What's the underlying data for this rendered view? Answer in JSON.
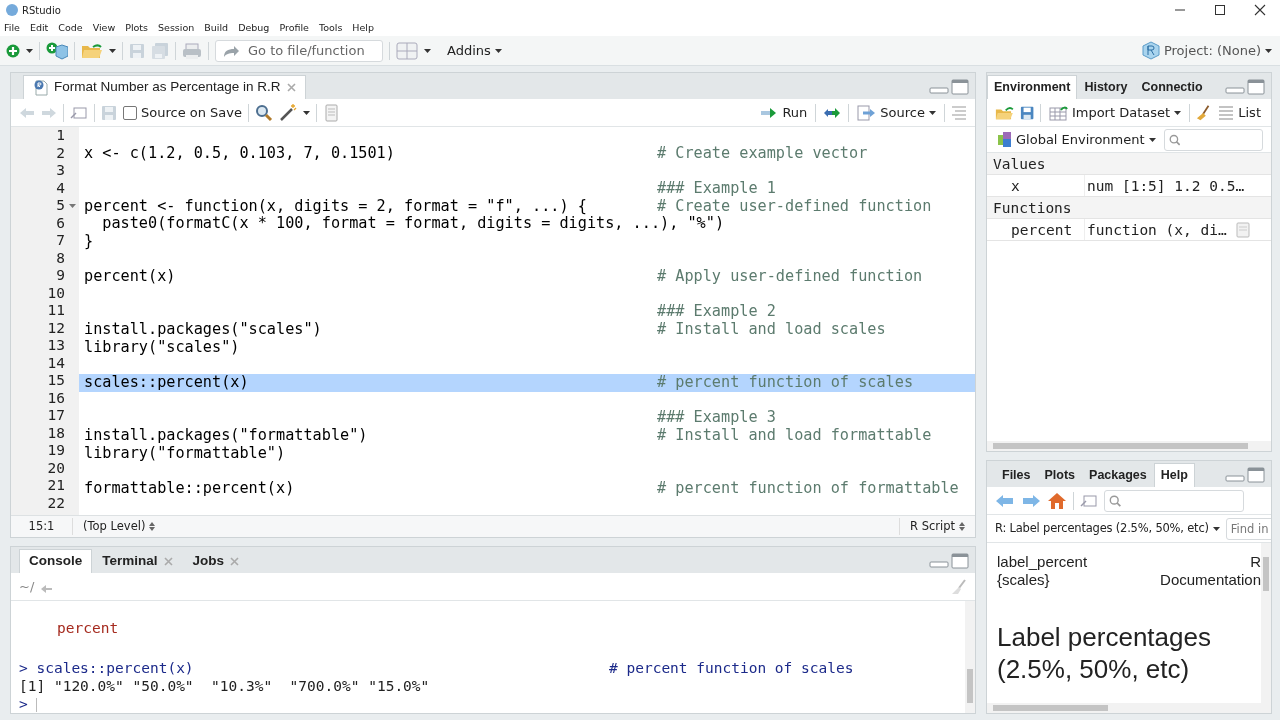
{
  "window": {
    "title": "RStudio"
  },
  "menu": [
    "File",
    "Edit",
    "Code",
    "View",
    "Plots",
    "Session",
    "Build",
    "Debug",
    "Profile",
    "Tools",
    "Help"
  ],
  "toolbar": {
    "goto_placeholder": "Go to file/function",
    "addins": "Addins",
    "project": "Project: (None)"
  },
  "source": {
    "tabs": [
      {
        "label": "Format Number as Percentage in R.R",
        "selected": true
      }
    ],
    "source_on_save": {
      "label": "Source on Save",
      "checked": false
    },
    "run": "Run",
    "source_button": "Source",
    "lines": [
      {
        "number": "1",
        "selected": false
      },
      {
        "number": "2",
        "code": "x <- c(1.2, 0.5, 0.103, 7, 0.1501)",
        "comment": "# Create example vector",
        "selected": false
      },
      {
        "number": "3",
        "selected": false
      },
      {
        "number": "4",
        "comment": "### Example 1",
        "selected": false
      },
      {
        "number": "5",
        "code": "percent <- function(x, digits = 2, format = \"f\", ...) {",
        "comment": "# Create user-defined function",
        "selected": false,
        "fold": true
      },
      {
        "number": "6",
        "code": "  paste0(formatC(x * 100, format = format, digits = digits, ...), \"%\")",
        "selected": false
      },
      {
        "number": "7",
        "code": "}",
        "selected": false
      },
      {
        "number": "8",
        "selected": false
      },
      {
        "number": "9",
        "code": "percent(x)",
        "comment": "# Apply user-defined function",
        "selected": false
      },
      {
        "number": "10",
        "selected": false
      },
      {
        "number": "11",
        "comment": "### Example 2",
        "selected": false
      },
      {
        "number": "12",
        "code": "install.packages(\"scales\")",
        "comment": "# Install and load scales",
        "selected": false
      },
      {
        "number": "13",
        "code": "library(\"scales\")",
        "selected": false
      },
      {
        "number": "14",
        "selected": false
      },
      {
        "number": "15",
        "code": "scales::percent(x)",
        "comment": "# percent function of scales",
        "selected": true
      },
      {
        "number": "16",
        "selected": false
      },
      {
        "number": "17",
        "comment": "### Example 3",
        "selected": false
      },
      {
        "number": "18",
        "code": "install.packages(\"formattable\")",
        "comment": "# Install and load formattable",
        "selected": false
      },
      {
        "number": "19",
        "code": "library(\"formattable\")",
        "selected": false
      },
      {
        "number": "20",
        "selected": false
      },
      {
        "number": "21",
        "code": "formattable::percent(x)",
        "comment": "# percent function of formattable",
        "selected": false
      },
      {
        "number": "22",
        "selected": false
      }
    ],
    "status": {
      "position": "15:1",
      "scope": "(Top Level)",
      "file_type": "R Script"
    }
  },
  "console": {
    "tabs": [
      {
        "label": "Console",
        "selected": true,
        "closable": false
      },
      {
        "label": "Terminal",
        "selected": false,
        "closable": true
      },
      {
        "label": "Jobs",
        "selected": false,
        "closable": true
      }
    ],
    "path": "~/",
    "lines": [
      {
        "kind": "message",
        "text": "percent"
      },
      {
        "kind": "blank"
      },
      {
        "kind": "input",
        "prompt": ">",
        "code": "scales::percent(x)",
        "comment": "# percent function of scales"
      },
      {
        "kind": "output",
        "text": "[1] \"120.0%\" \"50.0%\"  \"10.3%\"  \"700.0%\" \"15.0%\""
      },
      {
        "kind": "prompt",
        "prompt": ">"
      }
    ]
  },
  "environment": {
    "tabs": [
      {
        "label": "Environment",
        "selected": true
      },
      {
        "label": "History",
        "selected": false
      },
      {
        "label": "Connectio",
        "selected": false
      }
    ],
    "import": "Import Dataset",
    "view": "List",
    "scope": "Global Environment",
    "sections": [
      {
        "title": "Values",
        "rows": [
          {
            "name": "x",
            "value": "num [1:5] 1.2 0.5…",
            "viewable": false
          }
        ]
      },
      {
        "title": "Functions",
        "rows": [
          {
            "name": "percent",
            "value": "function (x, di…",
            "viewable": true
          }
        ]
      }
    ]
  },
  "help": {
    "tabs": [
      {
        "label": "Files",
        "selected": false
      },
      {
        "label": "Plots",
        "selected": false
      },
      {
        "label": "Packages",
        "selected": false
      },
      {
        "label": "Help",
        "selected": true
      }
    ],
    "topic": "R: Label percentages (2.5%, 50%, etc)",
    "find_placeholder": "Find in",
    "page_name": "label_percent {scales}",
    "page_doc": "R Documentation",
    "heading": "Label percentages (2.5%, 50%, etc)"
  }
}
